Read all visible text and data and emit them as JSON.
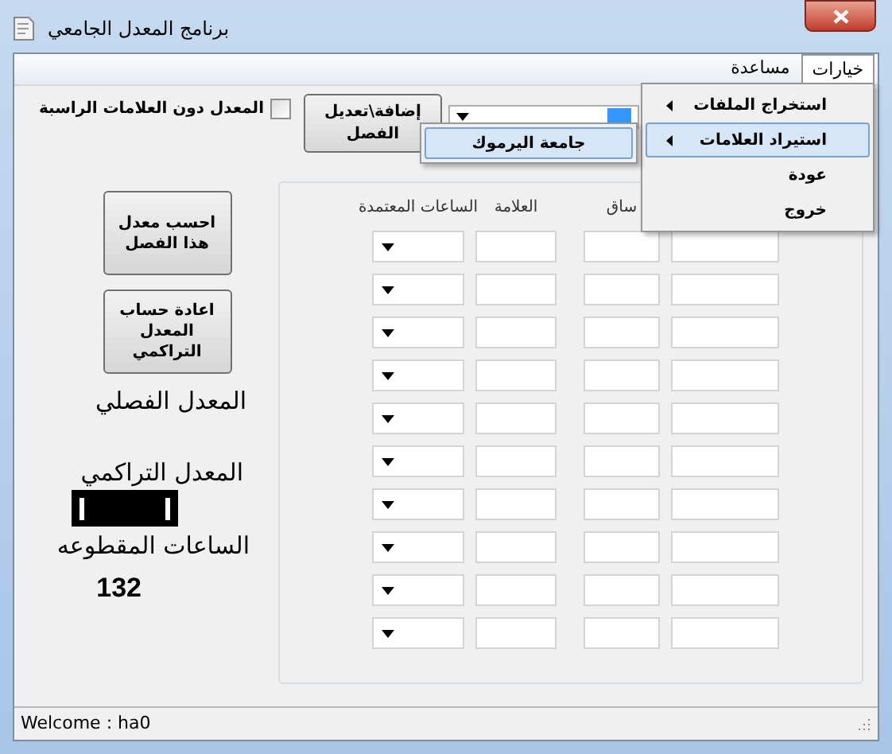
{
  "window": {
    "title": "برنامج  المعدل الجامعي"
  },
  "menu": [
    {
      "label": "خيارات",
      "selected": true
    },
    {
      "label": "مساعدة",
      "selected": false
    }
  ],
  "options_menu": {
    "items": [
      {
        "label": "استخراج الملفات",
        "has_submenu": true,
        "selected": false
      },
      {
        "label": "استيراد العلامات",
        "has_submenu": true,
        "selected": true
      },
      {
        "label": "عودة",
        "has_submenu": false,
        "selected": false
      },
      {
        "label": "خروج",
        "has_submenu": false,
        "selected": false
      }
    ]
  },
  "submenu": {
    "items": [
      {
        "label": "جامعة اليرموك",
        "selected": true
      }
    ]
  },
  "exclude_failed": {
    "label": "المعدل دون العلامات الراسبة",
    "checked": false
  },
  "add_edit_button": "إضافة\\تعديل الفصل",
  "buttons": [
    "احسب معدل هذا الفصل",
    "اعادة حساب المعدل التراكمي"
  ],
  "semester_gpa_label": "المعدل الفصلي",
  "cumulative_gpa_label": "المعدل التراكمي",
  "hours_label": "الساعات المقطوعه",
  "hours_value": "132",
  "table": {
    "columns": [
      "ساق",
      "العلامة",
      "الساعات المعتمدة"
    ],
    "rows": [
      {
        "cells": [
          {
            "kind": "input"
          },
          {
            "kind": "input"
          },
          {
            "kind": "input"
          },
          {
            "kind": "dropdown"
          }
        ]
      },
      {
        "cells": [
          {
            "kind": "input"
          },
          {
            "kind": "input"
          },
          {
            "kind": "input"
          },
          {
            "kind": "dropdown"
          }
        ]
      },
      {
        "cells": [
          {
            "kind": "input"
          },
          {
            "kind": "input"
          },
          {
            "kind": "input"
          },
          {
            "kind": "dropdown"
          }
        ]
      },
      {
        "cells": [
          {
            "kind": "input"
          },
          {
            "kind": "input"
          },
          {
            "kind": "input"
          },
          {
            "kind": "dropdown"
          }
        ]
      },
      {
        "cells": [
          {
            "kind": "input"
          },
          {
            "kind": "input"
          },
          {
            "kind": "input"
          },
          {
            "kind": "dropdown"
          }
        ]
      },
      {
        "cells": [
          {
            "kind": "input"
          },
          {
            "kind": "input"
          },
          {
            "kind": "input"
          },
          {
            "kind": "dropdown"
          }
        ]
      },
      {
        "cells": [
          {
            "kind": "input"
          },
          {
            "kind": "input"
          },
          {
            "kind": "input"
          },
          {
            "kind": "dropdown"
          }
        ]
      },
      {
        "cells": [
          {
            "kind": "input"
          },
          {
            "kind": "input"
          },
          {
            "kind": "input"
          },
          {
            "kind": "dropdown"
          }
        ]
      },
      {
        "cells": [
          {
            "kind": "input"
          },
          {
            "kind": "input"
          },
          {
            "kind": "input"
          },
          {
            "kind": "dropdown"
          }
        ]
      },
      {
        "cells": [
          {
            "kind": "input"
          },
          {
            "kind": "input"
          },
          {
            "kind": "input"
          },
          {
            "kind": "dropdown"
          }
        ]
      }
    ]
  },
  "status_bar": "Welcome : ha0"
}
